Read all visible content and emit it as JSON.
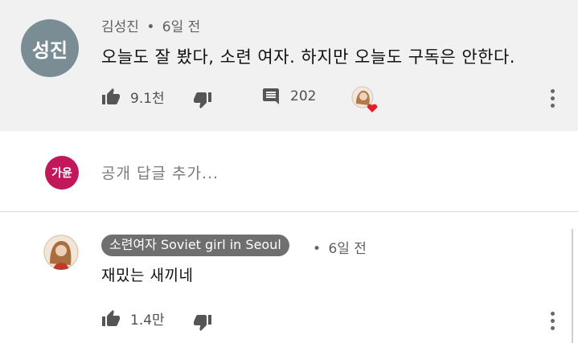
{
  "top_comment": {
    "avatar_text": "성진",
    "author": "김성진",
    "separator": "•",
    "time": "6일 전",
    "text": "오늘도 잘 봤다, 소련 여자. 하지만 오늘도 구독은 안한다.",
    "likes": "9.1천",
    "replies": "202",
    "colors": {
      "avatar_bg": "#7a8d94",
      "heart": "#e0202a"
    }
  },
  "reply_box": {
    "avatar_text": "가윤",
    "placeholder": "공개 답글 추가...",
    "colors": {
      "avatar_bg": "#c2185b"
    }
  },
  "reply": {
    "channel_name": "소련여자 Soviet girl in Seoul",
    "separator": "•",
    "time": "6일 전",
    "text": "재밌는 새끼네",
    "likes": "1.4만",
    "colors": {
      "badge_bg": "#6f6f6f"
    }
  },
  "icons": [
    "thumb-up-icon",
    "thumb-down-icon",
    "reply-icon",
    "heart-badge-icon",
    "more-vert-icon"
  ]
}
